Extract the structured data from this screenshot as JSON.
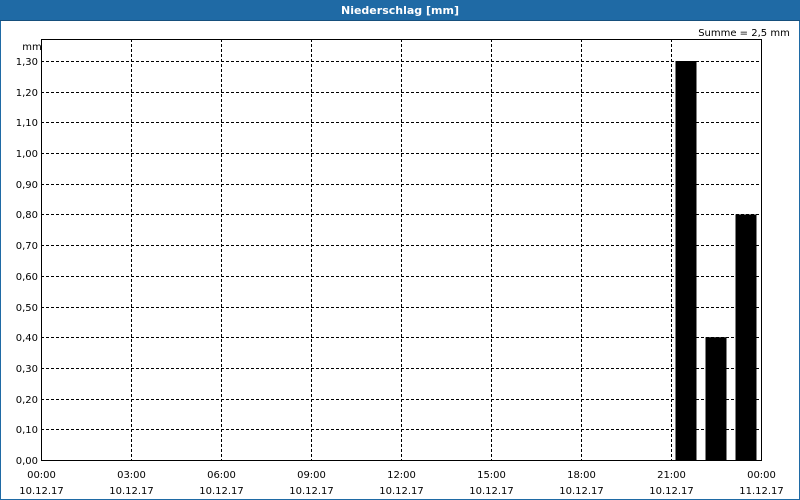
{
  "window": {
    "title": "Niederschlag [mm]"
  },
  "chart_data": {
    "type": "bar",
    "title": "Niederschlag [mm]",
    "ylabel": "mm",
    "annotation": "Summe = 2,5 mm",
    "ylim": [
      0,
      1.3
    ],
    "yticks": [
      "0,00",
      "0,10",
      "0,20",
      "0,30",
      "0,40",
      "0,50",
      "0,60",
      "0,70",
      "0,80",
      "0,90",
      "1,00",
      "1,10",
      "1,20",
      "1,30"
    ],
    "xlim_hours": [
      0,
      24
    ],
    "xticks": [
      {
        "time": "00:00",
        "date": "10.12.17"
      },
      {
        "time": "03:00",
        "date": "10.12.17"
      },
      {
        "time": "06:00",
        "date": "10.12.17"
      },
      {
        "time": "09:00",
        "date": "10.12.17"
      },
      {
        "time": "12:00",
        "date": "10.12.17"
      },
      {
        "time": "15:00",
        "date": "10.12.17"
      },
      {
        "time": "18:00",
        "date": "10.12.17"
      },
      {
        "time": "21:00",
        "date": "10.12.17"
      },
      {
        "time": "00:00",
        "date": "11.12.17"
      }
    ],
    "bars": [
      {
        "hour": 21.5,
        "value": 1.3
      },
      {
        "hour": 22.5,
        "value": 0.4
      },
      {
        "hour": 23.5,
        "value": 0.8
      }
    ],
    "bar_color": "#000000",
    "grid": true
  }
}
